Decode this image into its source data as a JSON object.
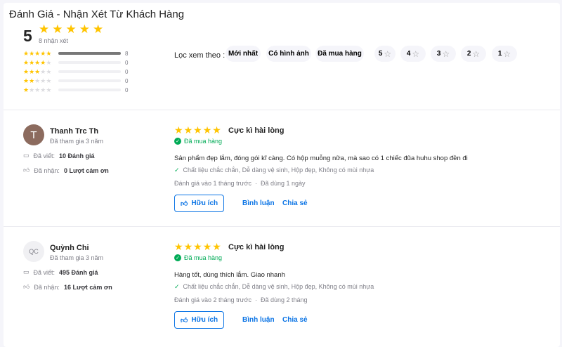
{
  "header": {
    "title": "Đánh Giá - Nhận Xét Từ Khách Hàng"
  },
  "summary": {
    "average": "5",
    "average_value": 5,
    "count_label": "8 nhận xét",
    "distribution": [
      {
        "stars": 5,
        "count": "8",
        "fraction": 1
      },
      {
        "stars": 4,
        "count": "0",
        "fraction": 0
      },
      {
        "stars": 3,
        "count": "0",
        "fraction": 0
      },
      {
        "stars": 2,
        "count": "0",
        "fraction": 0
      },
      {
        "stars": 1,
        "count": "0",
        "fraction": 0
      }
    ]
  },
  "filter": {
    "label": "Lọc xem theo :",
    "chips": [
      "Mới nhất",
      "Có hình ảnh",
      "Đã mua hàng"
    ],
    "star_chips": [
      "5",
      "4",
      "3",
      "2",
      "1"
    ]
  },
  "colors": {
    "star": "#ffc400",
    "accent": "#0b74e5",
    "verified": "#00ab56"
  },
  "reviews": [
    {
      "avatar_text": "T",
      "avatar_color": "#8c6b5e",
      "name": "Thanh Trc Th",
      "joined": "Đã tham gia 3 năm",
      "written_label": "Đã viết:",
      "written": "10 Đánh giá",
      "received_label": "Đã nhận:",
      "received": "0 Lượt cảm ơn",
      "rating": 5,
      "title": "Cực kì hài lòng",
      "verified": "Đã mua hàng",
      "content": "Sản phẩm đẹp lắm, đóng gói kĩ càng. Có hộp muỗng nữa, mà sao có 1 chiếc đũa huhu shop đền đi",
      "attributes": "Chất liệu chắc chắn, Dễ dàng vệ sinh, Hộp đẹp, Không có mùi nhựa",
      "date": "Đánh giá vào 1 tháng trước",
      "used": "Đã dùng 1 ngày",
      "helpful": "Hữu ích",
      "comment": "Bình luận",
      "share": "Chia sẻ"
    },
    {
      "avatar_text": "QC",
      "avatar_color": "#f0f0f3",
      "name": "Quỳnh Chi",
      "joined": "Đã tham gia 3 năm",
      "written_label": "Đã viết:",
      "written": "495 Đánh giá",
      "received_label": "Đã nhận:",
      "received": "16 Lượt cảm ơn",
      "rating": 5,
      "title": "Cực kì hài lòng",
      "verified": "Đã mua hàng",
      "content": "Hàng tốt, dùng thích lắm. Giao nhanh",
      "attributes": "Chất liệu chắc chắn, Dễ dàng vệ sinh, Hộp đẹp, Không có mùi nhựa",
      "date": "Đánh giá vào 2 tháng trước",
      "used": "Đã dùng 2 tháng",
      "helpful": "Hữu ích",
      "comment": "Bình luận",
      "share": "Chia sẻ"
    }
  ]
}
